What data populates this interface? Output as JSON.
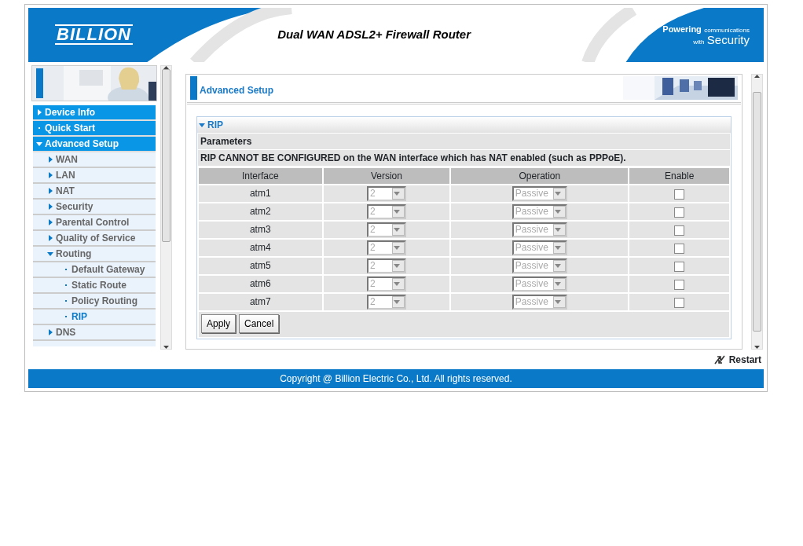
{
  "header": {
    "logo": "BILLION",
    "title": "Dual WAN ADSL2+ Firewall Router",
    "tagline_top": "Powering",
    "tagline_small": "communications",
    "tagline_with": "with",
    "tagline_big": "Security"
  },
  "sidebar": {
    "items": [
      {
        "label": "Device Info",
        "kind": "group",
        "expanded": false,
        "selected": false
      },
      {
        "label": "Quick Start",
        "kind": "group-leaf",
        "selected": false
      },
      {
        "label": "Advanced Setup",
        "kind": "group",
        "expanded": true,
        "selected": false,
        "children": [
          {
            "label": "WAN",
            "kind": "sub",
            "expanded": false,
            "selected": false
          },
          {
            "label": "LAN",
            "kind": "sub",
            "expanded": false,
            "selected": false
          },
          {
            "label": "NAT",
            "kind": "sub",
            "expanded": false,
            "selected": false
          },
          {
            "label": "Security",
            "kind": "sub",
            "expanded": false,
            "selected": false
          },
          {
            "label": "Parental Control",
            "kind": "sub",
            "expanded": false,
            "selected": false
          },
          {
            "label": "Quality of Service",
            "kind": "sub",
            "expanded": false,
            "selected": false
          },
          {
            "label": "Routing",
            "kind": "sub",
            "expanded": true,
            "selected": false,
            "children": [
              {
                "label": "Default Gateway",
                "kind": "leaf",
                "selected": false
              },
              {
                "label": "Static Route",
                "kind": "leaf",
                "selected": false
              },
              {
                "label": "Policy Routing",
                "kind": "leaf",
                "selected": false
              },
              {
                "label": "RIP",
                "kind": "leaf",
                "selected": true
              }
            ]
          },
          {
            "label": "DNS",
            "kind": "sub",
            "expanded": false,
            "selected": false
          }
        ]
      }
    ]
  },
  "content": {
    "title": "Advanced Setup",
    "section": {
      "title": "RIP",
      "expanded": true
    },
    "parameters_label": "Parameters",
    "note": "RIP CANNOT BE CONFIGURED on the WAN interface which has NAT enabled (such as PPPoE).",
    "table": {
      "columns": [
        "Interface",
        "Version",
        "Operation",
        "Enable"
      ],
      "rows": [
        {
          "interface": "atm1",
          "version": "2",
          "operation": "Passive",
          "enabled": false,
          "disabled": true
        },
        {
          "interface": "atm2",
          "version": "2",
          "operation": "Passive",
          "enabled": false,
          "disabled": true
        },
        {
          "interface": "atm3",
          "version": "2",
          "operation": "Passive",
          "enabled": false,
          "disabled": true
        },
        {
          "interface": "atm4",
          "version": "2",
          "operation": "Passive",
          "enabled": false,
          "disabled": true
        },
        {
          "interface": "atm5",
          "version": "2",
          "operation": "Passive",
          "enabled": false,
          "disabled": true
        },
        {
          "interface": "atm6",
          "version": "2",
          "operation": "Passive",
          "enabled": false,
          "disabled": true
        },
        {
          "interface": "atm7",
          "version": "2",
          "operation": "Passive",
          "enabled": false,
          "disabled": true
        }
      ]
    },
    "buttons": [
      "Apply",
      "Cancel"
    ]
  },
  "restart": "Restart",
  "footer": "Copyright @ Billion Electric Co., Ltd. All rights reserved."
}
